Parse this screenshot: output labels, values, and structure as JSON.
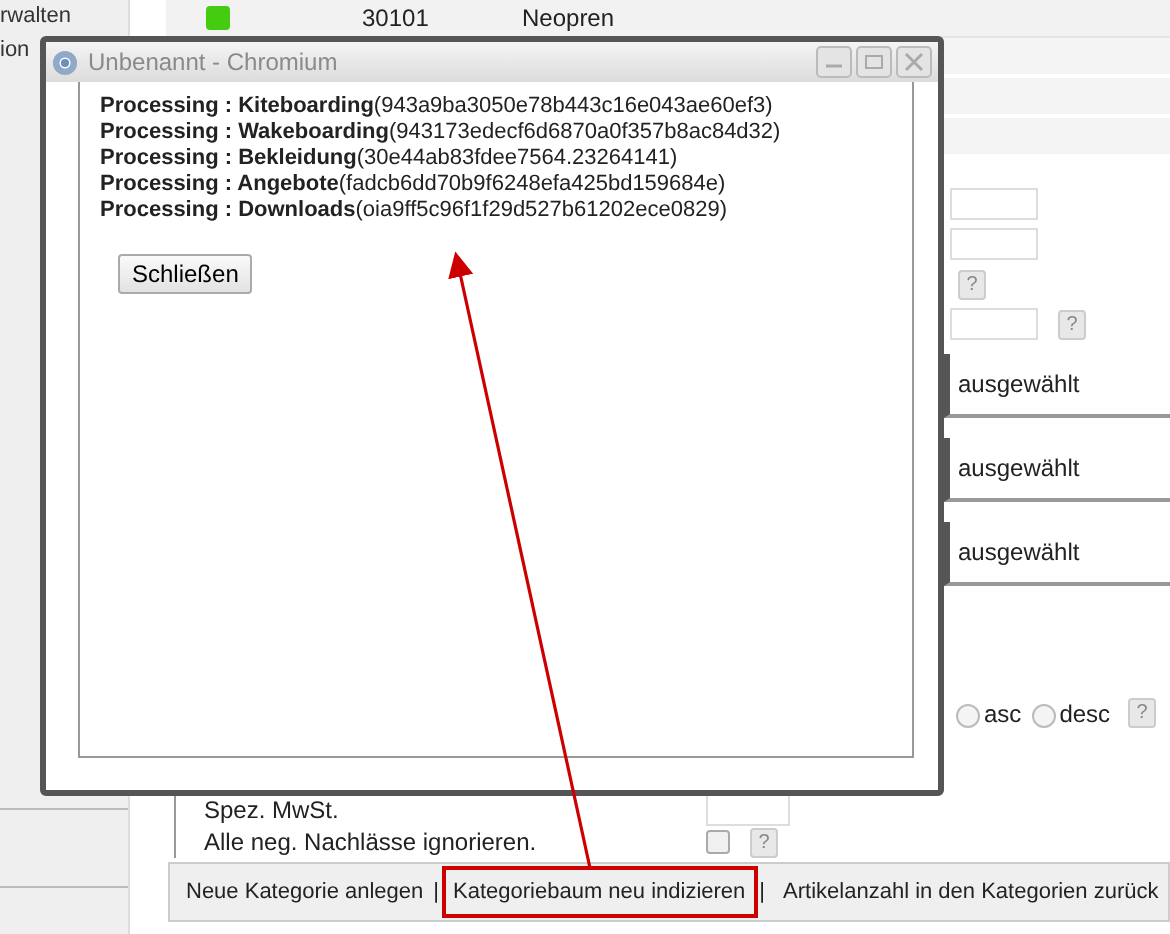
{
  "sidebar": {
    "items": [
      "rwalten",
      "ion"
    ]
  },
  "table_row": {
    "cells": [
      "30101",
      "Neopren"
    ]
  },
  "form": {
    "rows": [
      {
        "kind": "input",
        "value": ""
      },
      {
        "kind": "input",
        "value": ""
      },
      {
        "kind": "help",
        "label": "?"
      },
      {
        "kind": "input_help",
        "value": "",
        "help": "?"
      },
      {
        "kind": "select",
        "value": "ausgewählt"
      },
      {
        "kind": "select",
        "value": "ausgewählt"
      },
      {
        "kind": "select",
        "value": "ausgewählt"
      },
      {
        "kind": "radios",
        "options": [
          {
            "label": "asc",
            "selected": false
          },
          {
            "label": "desc",
            "selected": false
          }
        ],
        "help": "?"
      },
      {
        "kind": "label_input",
        "label": "Spez. MwSt.",
        "value": ""
      },
      {
        "kind": "label_checkbox",
        "label": "Alle neg. Nachlässe ignorieren.",
        "checked": false,
        "help": "?"
      }
    ]
  },
  "toolbar": {
    "items": [
      {
        "label": "Neue Kategorie anlegen",
        "separator": "|",
        "highlighted": false
      },
      {
        "label": "Kategoriebaum neu indizieren",
        "separator": "|",
        "highlighted": true
      },
      {
        "label": "Artikelanzahl in den Kategorien zurück",
        "highlighted": false
      }
    ]
  },
  "dialog": {
    "title": "Unbenannt - Chromium",
    "lines": [
      "**Processing : Kiteboarding**(943a9ba3050e78b443c16e043ae60ef3)",
      "**Processing : Wakeboarding**(943173edecf6d6870a0f357b8ac84d32)",
      "**Processing : Bekleidung**(30e44ab83fdee7564.23264141)",
      "**Processing : Angebote**(fadcb6dd70b9f6248efa425bd159684e)",
      "**Processing : Downloads**(oia9ff5c96f1f29d527b61202ece0829)"
    ],
    "button": "Schließen"
  }
}
